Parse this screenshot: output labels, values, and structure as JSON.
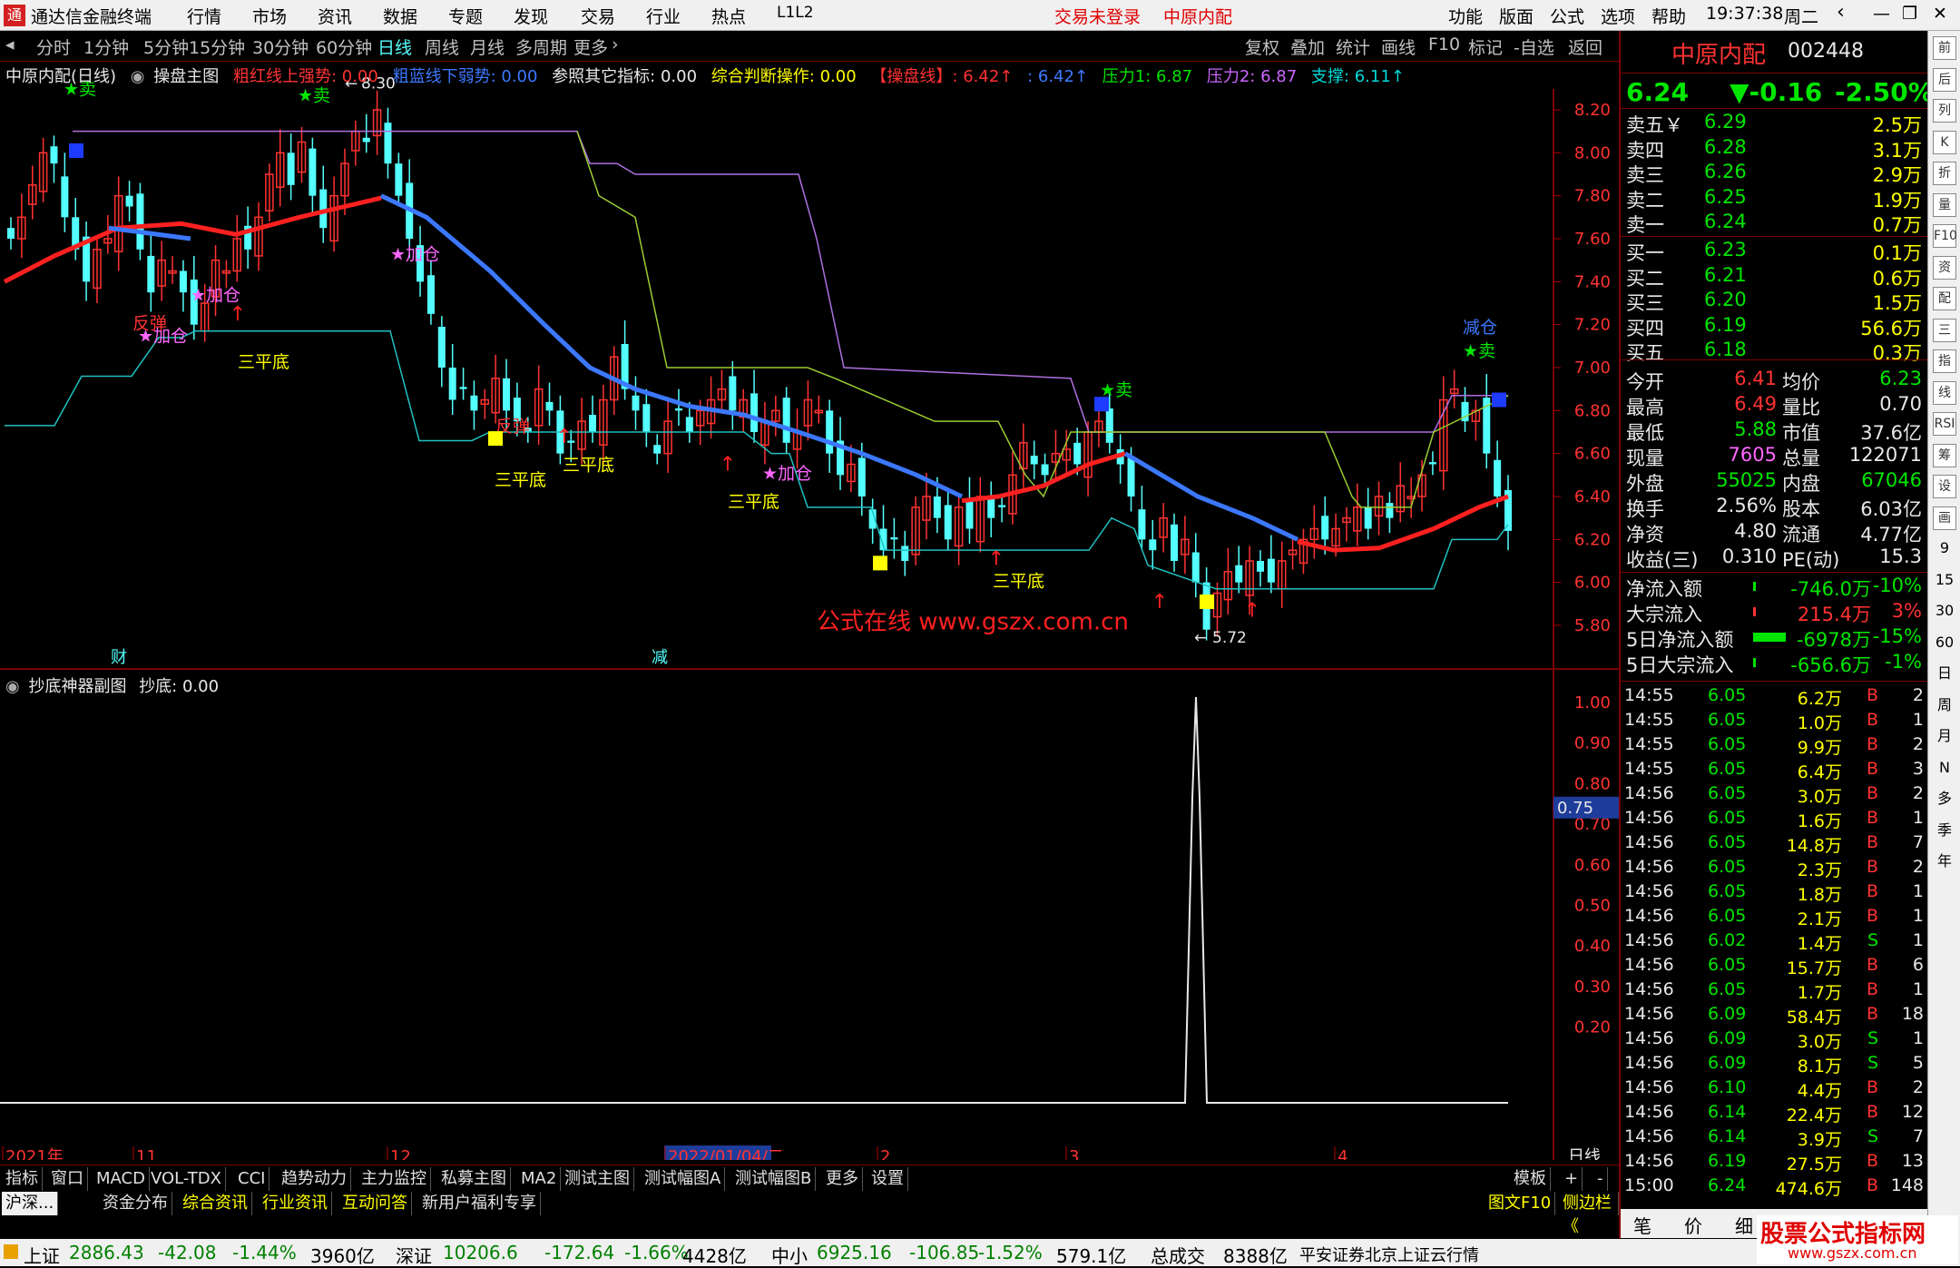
{
  "app": {
    "title": "通达信金融终端",
    "menu": [
      "行情",
      "市场",
      "资讯",
      "数据",
      "专题",
      "发现",
      "交易",
      "行业",
      "热点",
      "L1L2"
    ],
    "login_status": "交易未登录",
    "title_stock": "中原内配",
    "right_menu": [
      "功能",
      "版面",
      "公式",
      "选项",
      "帮助"
    ],
    "clock": "19:37:38",
    "weekday": "周二"
  },
  "period_bar": {
    "items": [
      "分时",
      "1分钟",
      "5分钟",
      "15分钟",
      "30分钟",
      "60分钟",
      "日线",
      "周线",
      "月线",
      "多周期",
      "更多"
    ],
    "active": "日线",
    "tools": [
      "复权",
      "叠加",
      "统计",
      "画线",
      "F10",
      "标记",
      "-自选",
      "返回"
    ]
  },
  "indicator_bar": {
    "name": "中原内配(日线)",
    "formula": "操盘主图",
    "items": [
      {
        "text": "粗红线上强势: 0.00",
        "color": "#ff3232"
      },
      {
        "text": "粗蓝线下弱势: 0.00",
        "color": "#3c78ff"
      },
      {
        "text": "参照其它指标: 0.00",
        "color": "#e8e8e8"
      },
      {
        "text": "综合判断操作: 0.00",
        "color": "#ffff00"
      },
      {
        "text": "【操盘线】: 6.42↑",
        "color": "#ff3232"
      },
      {
        "text": ": 6.42↑",
        "color": "#3c78ff"
      },
      {
        "text": "压力1: 6.87",
        "color": "#00e600"
      },
      {
        "text": "压力2: 6.87",
        "color": "#cc66ff"
      },
      {
        "text": "支撑: 6.11↑",
        "color": "#00d8d8"
      }
    ]
  },
  "chart_data": [
    {
      "type": "candlestick",
      "title": "中原内配(日线)",
      "ylim": [
        5.65,
        8.35
      ],
      "y_ticks": [
        "8.20",
        "8.00",
        "7.80",
        "7.60",
        "7.40",
        "7.20",
        "7.00",
        "6.80",
        "6.60",
        "6.40",
        "6.20",
        "6.00",
        "5.80"
      ],
      "x_labels": [
        "2021年",
        "11",
        "12",
        "2022/01/04/二",
        "2",
        "3",
        "4"
      ],
      "annotations": [
        "★卖",
        "★卖",
        "★加仓",
        "★加仓",
        "★加仓",
        "★加仓",
        "反弹",
        "反弹",
        "三平底",
        "三平底",
        "三平底",
        "三平底",
        "三平底",
        "三平底",
        "★卖",
        "减仓",
        "★卖",
        "财",
        "减"
      ],
      "high_label": "8.30",
      "low_label": "5.72",
      "watermark": "公式在线  www.gszx.com.cn",
      "series": [
        {
          "name": "粗红线/粗蓝线 (操盘线)",
          "color": "#ff2020/#3c78ff"
        },
        {
          "name": "压力1",
          "color": "#9acd32"
        },
        {
          "name": "压力2",
          "color": "#b070e0"
        },
        {
          "name": "支撑",
          "color": "#20c0c0"
        }
      ]
    },
    {
      "type": "line",
      "title": "抄底神器副图",
      "series": [
        {
          "name": "抄底",
          "values": [
            0.0
          ]
        }
      ],
      "ylim": [
        0,
        1.05
      ],
      "y_ticks": [
        "1.00",
        "0.90",
        "0.80",
        "0.70",
        "0.60",
        "0.50",
        "0.40",
        "0.30",
        "0.20"
      ],
      "current": "0.75",
      "spike_date": "2022-03 (5.72 low)",
      "spike_value": 1.0
    }
  ],
  "sub_bar": {
    "name": "抄底神器副图",
    "value": "抄底: 0.00"
  },
  "period_label": "日线",
  "bottom_tabs": {
    "row1": [
      "指标",
      "窗口",
      "MACD",
      "VOL-TDX",
      "CCI",
      "趋势动力",
      "主力监控",
      "私募主图",
      "MA2",
      "测试主图",
      "测试幅图A",
      "测试幅图B",
      "更多",
      "设置"
    ],
    "row2": [
      "沪深...",
      "资金分布",
      "综合资讯",
      "行业资讯",
      "互动问答",
      "新用户福利专享"
    ],
    "right": [
      "模板",
      "+",
      "-"
    ],
    "extra": [
      "图文F10",
      "侧边栏《"
    ]
  },
  "quote": {
    "name": "中原内配",
    "code": "002448",
    "price": "6.24",
    "change": "▼-0.16",
    "pct": "-2.50%",
    "asks": [
      {
        "label": "卖五￥",
        "price": "6.29",
        "vol": "2.5万"
      },
      {
        "label": "卖四",
        "price": "6.28",
        "vol": "3.1万"
      },
      {
        "label": "卖三",
        "price": "6.26",
        "vol": "2.9万"
      },
      {
        "label": "卖二",
        "price": "6.25",
        "vol": "1.9万"
      },
      {
        "label": "卖一",
        "price": "6.24",
        "vol": "0.7万"
      }
    ],
    "bids": [
      {
        "label": "买一",
        "price": "6.23",
        "vol": "0.1万"
      },
      {
        "label": "买二",
        "price": "6.21",
        "vol": "0.6万"
      },
      {
        "label": "买三",
        "price": "6.20",
        "vol": "1.5万"
      },
      {
        "label": "买四",
        "price": "6.19",
        "vol": "56.6万"
      },
      {
        "label": "买五",
        "price": "6.18",
        "vol": "0.3万"
      }
    ],
    "stats": [
      [
        "今开",
        "6.41",
        "均价",
        "6.23"
      ],
      [
        "最高",
        "6.49",
        "量比",
        "0.70"
      ],
      [
        "最低",
        "5.88",
        "市值",
        "37.6亿"
      ],
      [
        "现量",
        "7605",
        "总量",
        "122071"
      ],
      [
        "外盘",
        "55025",
        "内盘",
        "67046"
      ],
      [
        "换手",
        "2.56%",
        "股本",
        "6.03亿"
      ],
      [
        "净资",
        "4.80",
        "流通",
        "4.77亿"
      ],
      [
        "收益(三)",
        "0.310",
        "PE(动)",
        "15.3"
      ]
    ],
    "flows": [
      [
        "净流入额",
        "-746.0万",
        "-10%"
      ],
      [
        "大宗流入",
        "215.4万",
        "3%"
      ],
      [
        "5日净流入额",
        "-6978万",
        "-15%"
      ],
      [
        "5日大宗流入",
        "-656.6万",
        "-1%"
      ]
    ]
  },
  "ticks": [
    [
      "14:55",
      "6.05",
      "6.2万",
      "B",
      "2"
    ],
    [
      "14:55",
      "6.05",
      "1.0万",
      "B",
      "1"
    ],
    [
      "14:55",
      "6.05",
      "9.9万",
      "B",
      "2"
    ],
    [
      "14:55",
      "6.05",
      "6.4万",
      "B",
      "3"
    ],
    [
      "14:56",
      "6.05",
      "3.0万",
      "B",
      "2"
    ],
    [
      "14:56",
      "6.05",
      "1.6万",
      "B",
      "1"
    ],
    [
      "14:56",
      "6.05",
      "14.8万",
      "B",
      "7"
    ],
    [
      "14:56",
      "6.05",
      "2.3万",
      "B",
      "2"
    ],
    [
      "14:56",
      "6.05",
      "1.8万",
      "B",
      "1"
    ],
    [
      "14:56",
      "6.05",
      "2.1万",
      "B",
      "1"
    ],
    [
      "14:56",
      "6.02",
      "1.4万",
      "S",
      "1"
    ],
    [
      "14:56",
      "6.05",
      "15.7万",
      "B",
      "6"
    ],
    [
      "14:56",
      "6.05",
      "1.7万",
      "B",
      "1"
    ],
    [
      "14:56",
      "6.09",
      "58.4万",
      "B",
      "18"
    ],
    [
      "14:56",
      "6.09",
      "3.0万",
      "S",
      "1"
    ],
    [
      "14:56",
      "6.09",
      "8.1万",
      "S",
      "5"
    ],
    [
      "14:56",
      "6.10",
      "4.4万",
      "B",
      "2"
    ],
    [
      "14:56",
      "6.14",
      "22.4万",
      "B",
      "12"
    ],
    [
      "14:56",
      "6.14",
      "3.9万",
      "S",
      "7"
    ],
    [
      "14:56",
      "6.19",
      "27.5万",
      "B",
      "13"
    ],
    [
      "15:00",
      "6.24",
      "474.6万",
      "B",
      "148"
    ]
  ],
  "right_tabs": [
    "笔",
    "价",
    "细",
    "势"
  ],
  "status": {
    "sh_name": "上证",
    "sh": "2886.43",
    "sh_chg": "-42.08",
    "sh_pct": "-1.44%",
    "sh_amt": "3960亿",
    "sz_name": "深证",
    "sz": "10206.6",
    "sz_chg": "-172.64",
    "sz_pct": "-1.66%",
    "sz_amt": "4428亿",
    "zx_name": "中小",
    "zx": "6925.16",
    "zx_chg": "-106.85",
    "zx_pct": "-1.52%",
    "zx_amt": "579.1亿",
    "total_label": "总成交",
    "total": "8388亿",
    "source": "平安证券北京上证云行情",
    "brand": "股票公式指标网",
    "brand_url": "www.gszx.com.cn"
  },
  "side_icons": [
    "前",
    "后",
    "列",
    "K",
    "折",
    "量",
    "F10",
    "资",
    "配",
    "三",
    "指",
    "线",
    "RSI",
    "筹",
    "设",
    "画",
    "9",
    "15",
    "30",
    "60",
    "日",
    "周",
    "月",
    "N",
    "多",
    "季",
    "年"
  ],
  "colors": {
    "up": "#ff3232",
    "down": "#54ffff",
    "accent": "#ff3232",
    "blue": "#3c78ff"
  }
}
